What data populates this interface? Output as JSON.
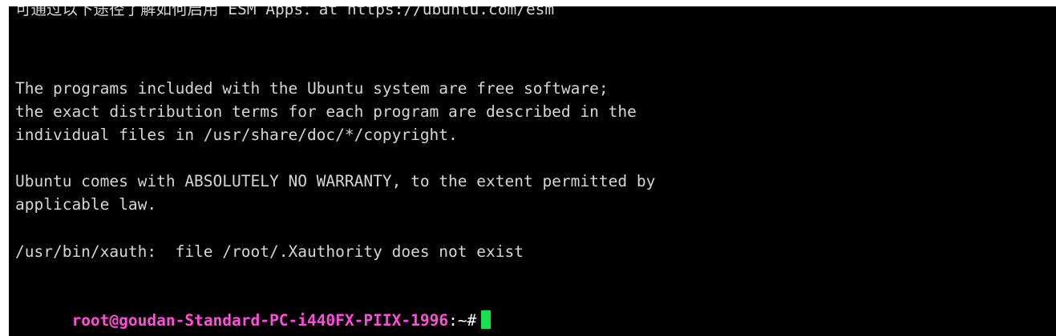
{
  "terminal": {
    "colors": {
      "background": "#000000",
      "text": "#d6d6d6",
      "prompt_user": "#ff4fd8",
      "cursor": "#17e34f"
    },
    "lines": [
      "可通过以下途径了解如何启用 ESM Apps：at https://ubuntu.com/esm",
      "The programs included with the Ubuntu system are free software;",
      "the exact distribution terms for each program are described in the",
      "individual files in /usr/share/doc/*/copyright.",
      "Ubuntu comes with ABSOLUTELY NO WARRANTY, to the extent permitted by",
      "applicable law.",
      "/usr/bin/xauth:  file /root/.Xauthority does not exist"
    ],
    "prompt": {
      "user_host": "root@goudan-Standard-PC-i440FX-PIIX-1996",
      "path": ":~#"
    }
  }
}
